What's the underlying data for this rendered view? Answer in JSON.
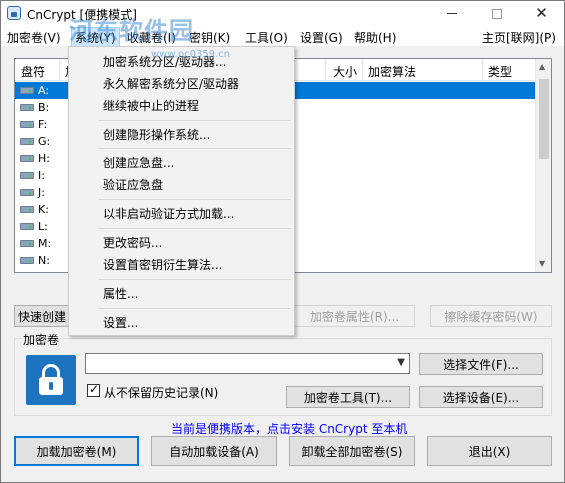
{
  "window": {
    "title": "CnCrypt [便携模式]",
    "watermark": "河东软件园",
    "watermark_url": "www.pc0359.cn"
  },
  "menubar": {
    "items": [
      "加密卷(V)",
      "系统(Y)",
      "收藏卷(I)",
      "密钥(K)",
      "工具(O)",
      "设置(G)",
      "帮助(H)"
    ],
    "right_item": "主页[联网](P)"
  },
  "drive_list": {
    "columns": [
      "盘符",
      "加",
      "大小",
      "加密算法",
      "类型"
    ],
    "drives": [
      "A:",
      "B:",
      "F:",
      "G:",
      "H:",
      "I:",
      "J:",
      "K:",
      "L:",
      "M:",
      "N:"
    ],
    "selected": "A:"
  },
  "system_menu": {
    "items": [
      "加密系统分区/驱动器...",
      "永久解密系统分区/驱动器",
      "继续被中止的进程",
      "创建隐形操作系统...",
      "创建应急盘...",
      "验证应急盘",
      "以非启动验证方式加载...",
      "更改密码...",
      "设置首密钥衍生算法...",
      "属性...",
      "设置..."
    ]
  },
  "toolbar": {
    "quick_create": "快速创建",
    "volume_properties": "加密卷属性(R)...",
    "wipe_cache": "擦除缓存密码(W)"
  },
  "volume_group": {
    "label": "加密卷",
    "path_value": "",
    "select_file": "选择文件(F)...",
    "no_history": "从不保留历史记录(N)",
    "no_history_checked": true,
    "volume_tools": "加密卷工具(T)...",
    "select_device": "选择设备(E)..."
  },
  "footer": {
    "portable_notice": "当前是便携版本，点击安装 CnCrypt 至本机",
    "mount": "加载加密卷(M)",
    "automount": "自动加载设备(A)",
    "dismount_all": "卸载全部加密卷(S)",
    "exit": "退出(X)"
  }
}
